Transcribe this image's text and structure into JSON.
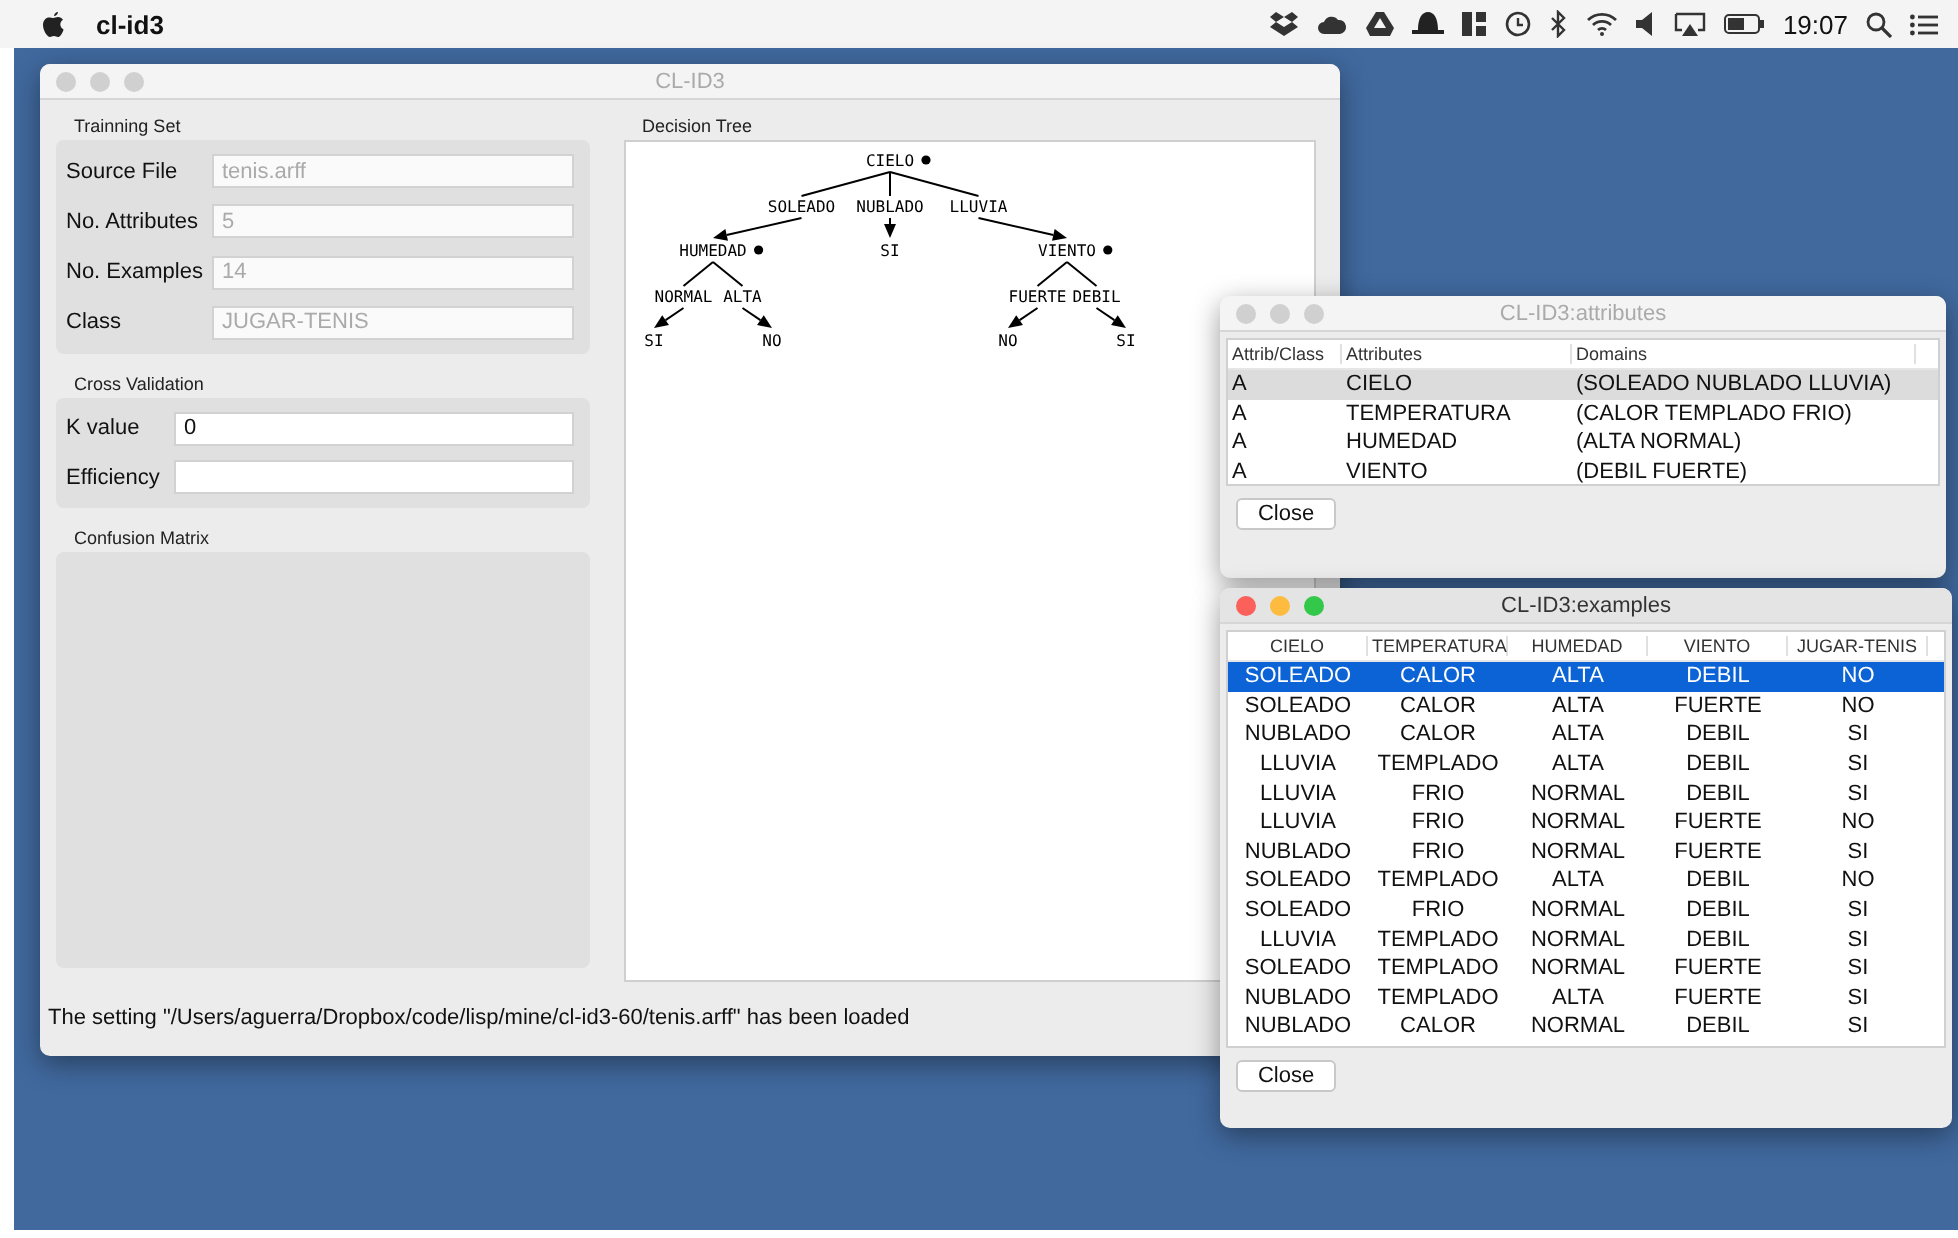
{
  "menu_bar": {
    "app_name": "cl-id3",
    "clock": "19:07"
  },
  "main_window": {
    "title": "CL-ID3",
    "active": false,
    "training_set": {
      "title": "Trainning Set",
      "fields": [
        {
          "label": "Source File",
          "value": "tenis.arff",
          "disabled": true
        },
        {
          "label": "No. Attributes",
          "value": "5",
          "disabled": true
        },
        {
          "label": "No. Examples",
          "value": "14",
          "disabled": true
        },
        {
          "label": "Class",
          "value": "JUGAR-TENIS",
          "disabled": true
        }
      ]
    },
    "cross_validation": {
      "title": "Cross Validation",
      "fields": [
        {
          "label": "K value",
          "value": "0"
        },
        {
          "label": "Efficiency"
        }
      ]
    },
    "confusion_matrix": {
      "title": "Confusion Matrix"
    },
    "decision_tree": {
      "title": "Decision Tree",
      "tree": {
        "label": "CIELO",
        "branches": [
          {
            "label": "SOLEADO",
            "node": {
              "label": "HUMEDAD",
              "branches": [
                {
                  "label": "NORMAL",
                  "node": {
                    "label": "SI"
                  }
                },
                {
                  "label": "ALTA",
                  "node": {
                    "label": "NO"
                  }
                }
              ]
            }
          },
          {
            "label": "NUBLADO",
            "node": {
              "label": "SI"
            }
          },
          {
            "label": "LLUVIA",
            "node": {
              "label": "VIENTO",
              "branches": [
                {
                  "label": "FUERTE",
                  "node": {
                    "label": "NO"
                  }
                },
                {
                  "label": "DEBIL",
                  "node": {
                    "label": "SI"
                  }
                }
              ]
            }
          }
        ]
      }
    },
    "status": "The setting \"/Users/aguerra/Dropbox/code/lisp/mine/cl-id3-60/tenis.arff\" has been loaded"
  },
  "attributes_window": {
    "title": "CL-ID3:attributes",
    "active": false,
    "columns": [
      "Attrib/Class",
      "Attributes",
      "Domains"
    ],
    "rows": [
      {
        "cells": [
          "A",
          "CIELO",
          "(SOLEADO NUBLADO LLUVIA)"
        ],
        "selected": true
      },
      {
        "cells": [
          "A",
          "TEMPERATURA",
          "(CALOR TEMPLADO FRIO)"
        ],
        "selected": false
      },
      {
        "cells": [
          "A",
          "HUMEDAD",
          "(ALTA NORMAL)"
        ],
        "selected": false
      },
      {
        "cells": [
          "A",
          "VIENTO",
          "(DEBIL FUERTE)"
        ],
        "selected": false
      }
    ],
    "close_button": "Close"
  },
  "examples_window": {
    "title": "CL-ID3:examples",
    "active": true,
    "columns": [
      "CIELO",
      "TEMPERATURA",
      "HUMEDAD",
      "VIENTO",
      "JUGAR-TENIS"
    ],
    "rows": [
      {
        "cells": [
          "SOLEADO",
          "CALOR",
          "ALTA",
          "DEBIL",
          "NO"
        ],
        "selected": true
      },
      {
        "cells": [
          "SOLEADO",
          "CALOR",
          "ALTA",
          "FUERTE",
          "NO"
        ],
        "selected": false
      },
      {
        "cells": [
          "NUBLADO",
          "CALOR",
          "ALTA",
          "DEBIL",
          "SI"
        ],
        "selected": false
      },
      {
        "cells": [
          "LLUVIA",
          "TEMPLADO",
          "ALTA",
          "DEBIL",
          "SI"
        ],
        "selected": false
      },
      {
        "cells": [
          "LLUVIA",
          "FRIO",
          "NORMAL",
          "DEBIL",
          "SI"
        ],
        "selected": false
      },
      {
        "cells": [
          "LLUVIA",
          "FRIO",
          "NORMAL",
          "FUERTE",
          "NO"
        ],
        "selected": false
      },
      {
        "cells": [
          "NUBLADO",
          "FRIO",
          "NORMAL",
          "FUERTE",
          "SI"
        ],
        "selected": false
      },
      {
        "cells": [
          "SOLEADO",
          "TEMPLADO",
          "ALTA",
          "DEBIL",
          "NO"
        ],
        "selected": false
      },
      {
        "cells": [
          "SOLEADO",
          "FRIO",
          "NORMAL",
          "DEBIL",
          "SI"
        ],
        "selected": false
      },
      {
        "cells": [
          "LLUVIA",
          "TEMPLADO",
          "NORMAL",
          "DEBIL",
          "SI"
        ],
        "selected": false
      },
      {
        "cells": [
          "SOLEADO",
          "TEMPLADO",
          "NORMAL",
          "FUERTE",
          "SI"
        ],
        "selected": false
      },
      {
        "cells": [
          "NUBLADO",
          "TEMPLADO",
          "ALTA",
          "FUERTE",
          "SI"
        ],
        "selected": false
      },
      {
        "cells": [
          "NUBLADO",
          "CALOR",
          "NORMAL",
          "DEBIL",
          "SI"
        ],
        "selected": false
      }
    ],
    "close_button": "Close"
  }
}
